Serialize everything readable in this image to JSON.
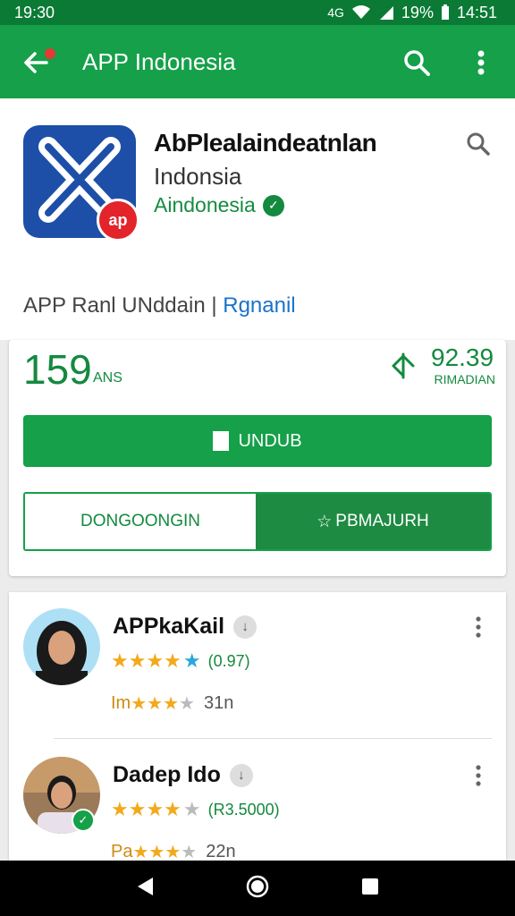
{
  "status_bar": {
    "time": "19:30",
    "battery": "19%",
    "clock": "14:51",
    "signal_text": "4G"
  },
  "app_bar": {
    "title": "APP Indonesia"
  },
  "app": {
    "name": "AbPlealaindeatnlan",
    "country": "Indonsia",
    "developer": "Aindonesia",
    "badge_text": "ap"
  },
  "rank": {
    "text": "APP Ranl UNddain | ",
    "link": "Rgnanil"
  },
  "stats": {
    "rating": "159",
    "rating_unit": "ANS",
    "downloads": "92.39",
    "downloads_unit": "RIMADIAN"
  },
  "buttons": {
    "install": "UNDUB",
    "secondary": "DONGOONGIN",
    "primary": "PBMAJURH"
  },
  "reviews": [
    {
      "name": "APPkaKail",
      "rating_stars": 5,
      "count": "(0.97)",
      "line2_prefix": "Im",
      "line2_stars": 4,
      "line2_num": "31n"
    },
    {
      "name": "Dadep Ido",
      "rating_stars": 4,
      "count": "(R3.5000)",
      "line2_prefix": "Pa",
      "line2_stars": 4,
      "line2_num": "22n"
    }
  ],
  "colors": {
    "primary": "#15a049",
    "status": "#0b7a35",
    "link": "#1a73c8",
    "star": "#f2a91c"
  }
}
